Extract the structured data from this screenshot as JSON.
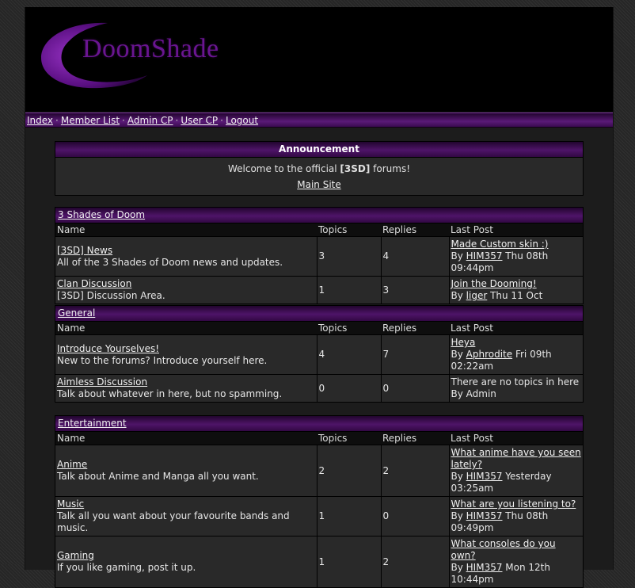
{
  "header": {
    "logo_text": "DoomShade"
  },
  "nav": [
    "Index",
    "Member List",
    "Admin CP",
    "User CP",
    "Logout"
  ],
  "announcement": {
    "title": "Announcement",
    "text_before": "Welcome to the official ",
    "text_bold": "[3SD]",
    "text_after": " forums!",
    "link": "Main Site"
  },
  "columns": {
    "name": "Name",
    "topics": "Topics",
    "replies": "Replies",
    "last_post": "Last Post"
  },
  "categories": [
    {
      "title": "3 Shades of Doom",
      "forums": [
        {
          "name": "[3SD] News",
          "desc": "All of the 3 Shades of Doom news and updates.",
          "topics": "3",
          "replies": "4",
          "last_title": "Made Custom skin :)",
          "by": "By ",
          "user": "HIM357",
          "date": " Thu 08th 09:44pm"
        },
        {
          "name": "Clan Discussion",
          "desc": "[3SD] Discussion Area.",
          "topics": "1",
          "replies": "3",
          "last_title": "Join the Dooming!",
          "by": "By ",
          "user": "liger",
          "date": " Thu 11 Oct"
        }
      ]
    },
    {
      "title": "General",
      "forums": [
        {
          "name": "Introduce Yourselves!",
          "desc": "New to the forums? Introduce yourself here.",
          "topics": "4",
          "replies": "7",
          "last_title": "Heya",
          "by": "By ",
          "user": "Aphrodite",
          "date": " Fri 09th 02:22am"
        },
        {
          "name": "Aimless Discussion",
          "desc": "Talk about whatever in here, but no spamming.",
          "topics": "0",
          "replies": "0",
          "last_title": "",
          "last_text": "There are no topics in here",
          "by": "By Admin",
          "user": "",
          "date": ""
        }
      ]
    },
    {
      "title": "Entertainment",
      "forums": [
        {
          "name": "Anime",
          "desc": "Talk about Anime and Manga all you want.",
          "topics": "2",
          "replies": "2",
          "last_title": "What anime have you seen lately?",
          "by": "By ",
          "user": "HIM357",
          "date": " Yesterday 03:25am"
        },
        {
          "name": "Music",
          "desc": "Talk all you want about your favourite bands and music.",
          "topics": "1",
          "replies": "0",
          "last_title": "What are you listening to?",
          "by": "By ",
          "user": "HIM357",
          "date": " Thu 08th 09:49pm"
        },
        {
          "name": "Gaming",
          "desc": "If you like gaming, post it up.",
          "topics": "1",
          "replies": "2",
          "last_title": "What consoles do you own?",
          "by": "By ",
          "user": "HIM357",
          "date": " Mon 12th 10:44pm"
        }
      ]
    }
  ]
}
